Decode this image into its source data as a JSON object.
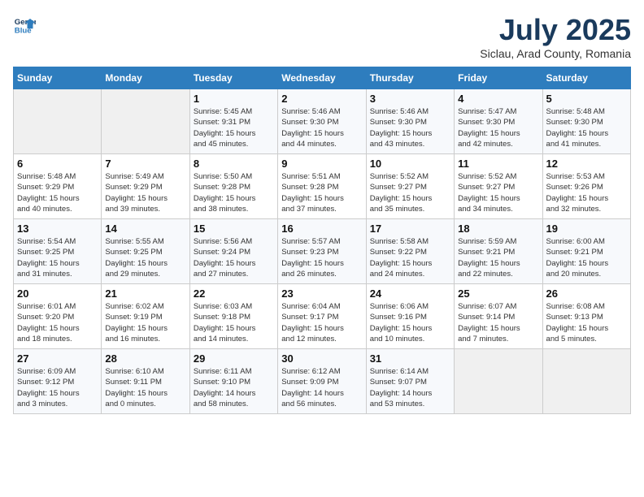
{
  "logo": {
    "line1": "General",
    "line2": "Blue"
  },
  "title": "July 2025",
  "subtitle": "Siclau, Arad County, Romania",
  "weekdays": [
    "Sunday",
    "Monday",
    "Tuesday",
    "Wednesday",
    "Thursday",
    "Friday",
    "Saturday"
  ],
  "weeks": [
    [
      {
        "day": "",
        "detail": ""
      },
      {
        "day": "",
        "detail": ""
      },
      {
        "day": "1",
        "detail": "Sunrise: 5:45 AM\nSunset: 9:31 PM\nDaylight: 15 hours\nand 45 minutes."
      },
      {
        "day": "2",
        "detail": "Sunrise: 5:46 AM\nSunset: 9:30 PM\nDaylight: 15 hours\nand 44 minutes."
      },
      {
        "day": "3",
        "detail": "Sunrise: 5:46 AM\nSunset: 9:30 PM\nDaylight: 15 hours\nand 43 minutes."
      },
      {
        "day": "4",
        "detail": "Sunrise: 5:47 AM\nSunset: 9:30 PM\nDaylight: 15 hours\nand 42 minutes."
      },
      {
        "day": "5",
        "detail": "Sunrise: 5:48 AM\nSunset: 9:30 PM\nDaylight: 15 hours\nand 41 minutes."
      }
    ],
    [
      {
        "day": "6",
        "detail": "Sunrise: 5:48 AM\nSunset: 9:29 PM\nDaylight: 15 hours\nand 40 minutes."
      },
      {
        "day": "7",
        "detail": "Sunrise: 5:49 AM\nSunset: 9:29 PM\nDaylight: 15 hours\nand 39 minutes."
      },
      {
        "day": "8",
        "detail": "Sunrise: 5:50 AM\nSunset: 9:28 PM\nDaylight: 15 hours\nand 38 minutes."
      },
      {
        "day": "9",
        "detail": "Sunrise: 5:51 AM\nSunset: 9:28 PM\nDaylight: 15 hours\nand 37 minutes."
      },
      {
        "day": "10",
        "detail": "Sunrise: 5:52 AM\nSunset: 9:27 PM\nDaylight: 15 hours\nand 35 minutes."
      },
      {
        "day": "11",
        "detail": "Sunrise: 5:52 AM\nSunset: 9:27 PM\nDaylight: 15 hours\nand 34 minutes."
      },
      {
        "day": "12",
        "detail": "Sunrise: 5:53 AM\nSunset: 9:26 PM\nDaylight: 15 hours\nand 32 minutes."
      }
    ],
    [
      {
        "day": "13",
        "detail": "Sunrise: 5:54 AM\nSunset: 9:25 PM\nDaylight: 15 hours\nand 31 minutes."
      },
      {
        "day": "14",
        "detail": "Sunrise: 5:55 AM\nSunset: 9:25 PM\nDaylight: 15 hours\nand 29 minutes."
      },
      {
        "day": "15",
        "detail": "Sunrise: 5:56 AM\nSunset: 9:24 PM\nDaylight: 15 hours\nand 27 minutes."
      },
      {
        "day": "16",
        "detail": "Sunrise: 5:57 AM\nSunset: 9:23 PM\nDaylight: 15 hours\nand 26 minutes."
      },
      {
        "day": "17",
        "detail": "Sunrise: 5:58 AM\nSunset: 9:22 PM\nDaylight: 15 hours\nand 24 minutes."
      },
      {
        "day": "18",
        "detail": "Sunrise: 5:59 AM\nSunset: 9:21 PM\nDaylight: 15 hours\nand 22 minutes."
      },
      {
        "day": "19",
        "detail": "Sunrise: 6:00 AM\nSunset: 9:21 PM\nDaylight: 15 hours\nand 20 minutes."
      }
    ],
    [
      {
        "day": "20",
        "detail": "Sunrise: 6:01 AM\nSunset: 9:20 PM\nDaylight: 15 hours\nand 18 minutes."
      },
      {
        "day": "21",
        "detail": "Sunrise: 6:02 AM\nSunset: 9:19 PM\nDaylight: 15 hours\nand 16 minutes."
      },
      {
        "day": "22",
        "detail": "Sunrise: 6:03 AM\nSunset: 9:18 PM\nDaylight: 15 hours\nand 14 minutes."
      },
      {
        "day": "23",
        "detail": "Sunrise: 6:04 AM\nSunset: 9:17 PM\nDaylight: 15 hours\nand 12 minutes."
      },
      {
        "day": "24",
        "detail": "Sunrise: 6:06 AM\nSunset: 9:16 PM\nDaylight: 15 hours\nand 10 minutes."
      },
      {
        "day": "25",
        "detail": "Sunrise: 6:07 AM\nSunset: 9:14 PM\nDaylight: 15 hours\nand 7 minutes."
      },
      {
        "day": "26",
        "detail": "Sunrise: 6:08 AM\nSunset: 9:13 PM\nDaylight: 15 hours\nand 5 minutes."
      }
    ],
    [
      {
        "day": "27",
        "detail": "Sunrise: 6:09 AM\nSunset: 9:12 PM\nDaylight: 15 hours\nand 3 minutes."
      },
      {
        "day": "28",
        "detail": "Sunrise: 6:10 AM\nSunset: 9:11 PM\nDaylight: 15 hours\nand 0 minutes."
      },
      {
        "day": "29",
        "detail": "Sunrise: 6:11 AM\nSunset: 9:10 PM\nDaylight: 14 hours\nand 58 minutes."
      },
      {
        "day": "30",
        "detail": "Sunrise: 6:12 AM\nSunset: 9:09 PM\nDaylight: 14 hours\nand 56 minutes."
      },
      {
        "day": "31",
        "detail": "Sunrise: 6:14 AM\nSunset: 9:07 PM\nDaylight: 14 hours\nand 53 minutes."
      },
      {
        "day": "",
        "detail": ""
      },
      {
        "day": "",
        "detail": ""
      }
    ]
  ]
}
